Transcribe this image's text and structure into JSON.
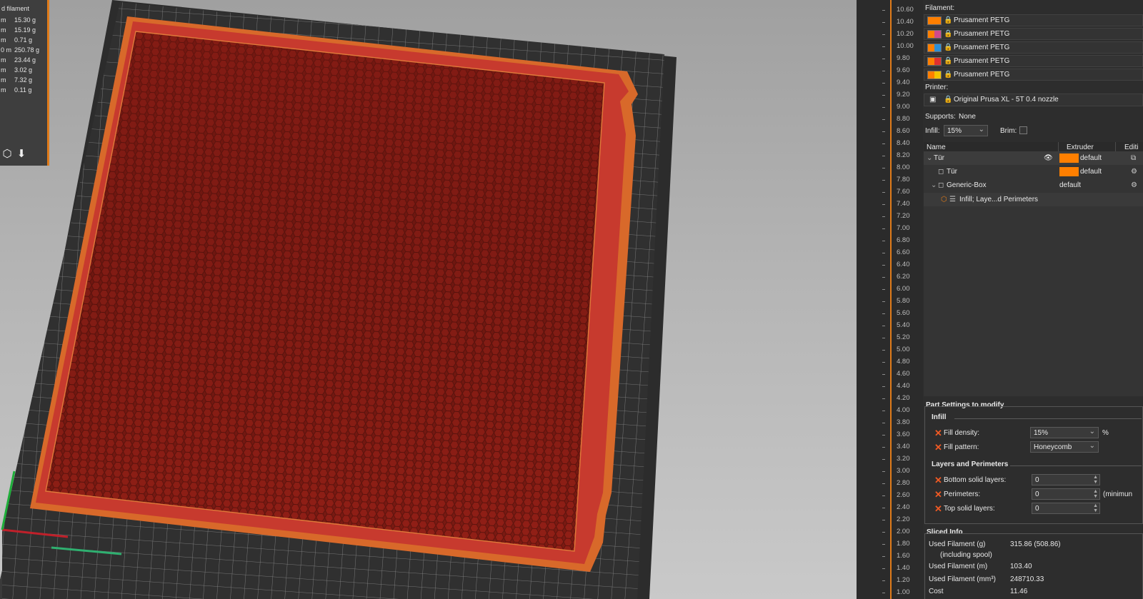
{
  "legend": {
    "title": "d filament",
    "rows": [
      {
        "length": "m",
        "weight": "15.30 g"
      },
      {
        "length": "m",
        "weight": "15.19 g"
      },
      {
        "length": "m",
        "weight": "0.71 g"
      },
      {
        "length": "0 m",
        "weight": "250.78 g"
      },
      {
        "length": "m",
        "weight": "23.44 g"
      },
      {
        "length": "m",
        "weight": "3.02 g"
      },
      {
        "length": "m",
        "weight": "7.32 g"
      },
      {
        "length": "m",
        "weight": "0.11 g"
      }
    ]
  },
  "layer_slider": {
    "labels": [
      "10.60",
      "10.40",
      "10.20",
      "10.00",
      "9.80",
      "9.60",
      "9.40",
      "9.20",
      "9.00",
      "8.80",
      "8.60",
      "8.40",
      "8.20",
      "8.00",
      "7.80",
      "7.60",
      "7.40",
      "7.20",
      "7.00",
      "6.80",
      "6.60",
      "6.40",
      "6.20",
      "6.00",
      "5.80",
      "5.60",
      "5.40",
      "5.20",
      "5.00",
      "4.80",
      "4.60",
      "4.40",
      "4.20",
      "4.00",
      "3.80",
      "3.60",
      "3.40",
      "3.20",
      "3.00",
      "2.80",
      "2.60",
      "2.40",
      "2.20",
      "2.00",
      "1.80",
      "1.60",
      "1.40",
      "1.20",
      "1.00"
    ],
    "accent_color": "#e07b1a"
  },
  "sidebar": {
    "filament_label": "Filament:",
    "filaments": [
      {
        "name": "Prusament PETG",
        "color": "#ff7f00",
        "color2": "#ff7f00"
      },
      {
        "name": "Prusament PETG",
        "color": "#ff7f00",
        "color2": "#d04a8c"
      },
      {
        "name": "Prusament PETG",
        "color": "#ff7f00",
        "color2": "#2e8fd6"
      },
      {
        "name": "Prusament PETG",
        "color": "#ff7f00",
        "color2": "#e03030"
      },
      {
        "name": "Prusament PETG",
        "color": "#ff7f00",
        "color2": "#f2c400"
      }
    ],
    "printer_label": "Printer:",
    "printer_name": "Original Prusa XL - 5T 0.4 nozzle",
    "supports_label": "Supports:",
    "supports_value": "None",
    "infill_label": "Infill:",
    "infill_value": "15%",
    "brim_label": "Brim:",
    "object_list": {
      "col_name": "Name",
      "col_extruder": "Extruder",
      "col_editing": "Editi",
      "rows": [
        {
          "name": "Tür",
          "extruder": "default"
        },
        {
          "name": "Tür",
          "extruder": "default"
        },
        {
          "name": "Generic-Box",
          "extruder": "default"
        },
        {
          "name": "Infill; Laye...d Perimeters"
        }
      ]
    },
    "part_settings": {
      "title": "Part Settings to modify",
      "infill_group": "Infill",
      "fill_density_label": "Fill density:",
      "fill_density_value": "15%",
      "fill_density_unit": "%",
      "fill_pattern_label": "Fill pattern:",
      "fill_pattern_value": "Honeycomb",
      "layers_group": "Layers and Perimeters",
      "bottom_label": "Bottom solid layers:",
      "bottom_value": "0",
      "perimeters_label": "Perimeters:",
      "perimeters_value": "0",
      "perimeters_note": "(minimun",
      "top_label": "Top solid layers:",
      "top_value": "0"
    },
    "sliced_info": {
      "title": "Sliced Info",
      "used_g_label": "Used Filament (g)",
      "used_g_sub": "(including spool)",
      "used_g_value": "315.86 (508.86)",
      "used_m_label": "Used Filament (m)",
      "used_m_value": "103.40",
      "used_mm3_label": "Used Filament (mm³)",
      "used_mm3_value": "248710.33",
      "cost_label": "Cost",
      "cost_value": "11.46"
    }
  }
}
